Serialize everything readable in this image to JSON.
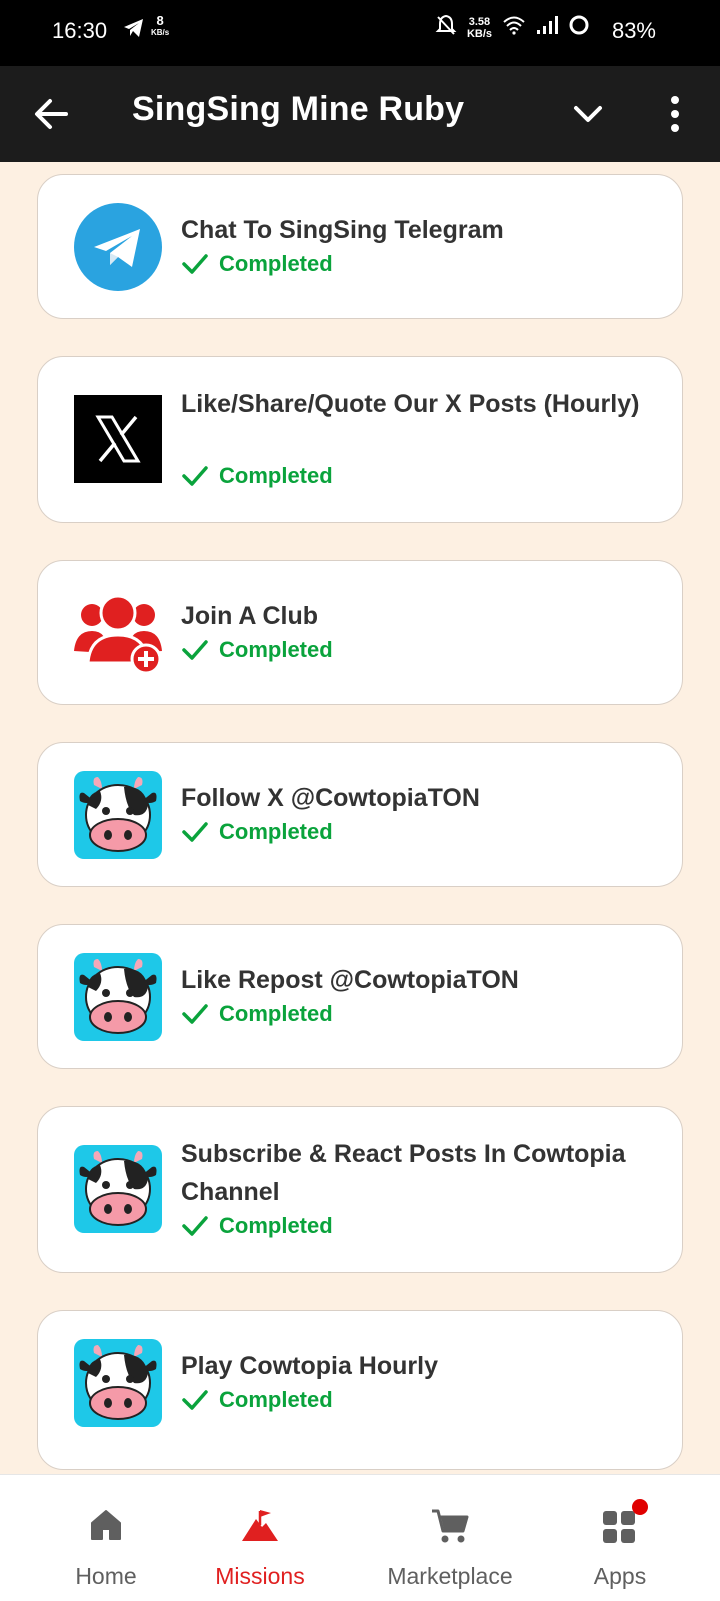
{
  "status_bar": {
    "time": "16:30",
    "net_small_value": "8",
    "net_small_unit": "KB/s",
    "speed_value": "3.58",
    "speed_unit": "KB/s",
    "battery": "83%"
  },
  "app_bar": {
    "title": "SingSing Mine Ruby"
  },
  "missions": [
    {
      "title": "Chat To SingSing Telegram",
      "status": "Completed",
      "icon": "telegram-icon"
    },
    {
      "title": "Like/Share/Quote Our X Posts (Hourly)",
      "status": "Completed",
      "icon": "x-logo-icon"
    },
    {
      "title": "Join A Club",
      "status": "Completed",
      "icon": "join-club-icon"
    },
    {
      "title": "Follow X @CowtopiaTON",
      "status": "Completed",
      "icon": "cowtopia-icon"
    },
    {
      "title": "Like Repost @CowtopiaTON",
      "status": "Completed",
      "icon": "cowtopia-icon"
    },
    {
      "title": "Subscribe & React Posts In Cowtopia Channel",
      "status": "Completed",
      "icon": "cowtopia-icon"
    },
    {
      "title": "Play Cowtopia Hourly",
      "status": "Completed",
      "icon": "cowtopia-icon"
    }
  ],
  "nav": [
    {
      "label": "Home",
      "icon": "home-icon"
    },
    {
      "label": "Missions",
      "icon": "missions-flag-icon",
      "active": true
    },
    {
      "label": "Marketplace",
      "icon": "cart-icon"
    },
    {
      "label": "Apps",
      "icon": "apps-icon"
    }
  ],
  "colors": {
    "accent_red": "#e02020",
    "completed_green": "#0aa33c",
    "background": "#fdf0e2",
    "appbar": "#1c1c1c"
  }
}
